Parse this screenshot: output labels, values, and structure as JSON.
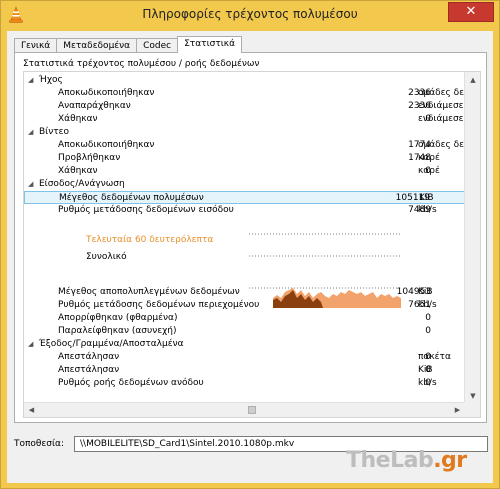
{
  "window": {
    "title": "Πληροφορίες τρέχοντος πολυμέσου",
    "close_glyph": "✕",
    "accent": "#f2c94c"
  },
  "tabs": [
    {
      "label": "Γενικά"
    },
    {
      "label": "Μεταδεδομένα"
    },
    {
      "label": "Codec"
    },
    {
      "label": "Στατιστικά",
      "active": true
    }
  ],
  "panel": {
    "caption": "Στατιστικά τρέχοντος πολυμέσου / ροής δεδομένων"
  },
  "tree": {
    "audio": {
      "label": "Ήχος",
      "rows": [
        {
          "label": "Αποκωδικοποιήθηκαν",
          "value": "2336",
          "unit": "ομάδες δεδομένων"
        },
        {
          "label": "Αναπαράχθηκαν",
          "value": "2336",
          "unit": "ενδιάμεσες μνήμης"
        },
        {
          "label": "Χάθηκαν",
          "value": "0",
          "unit": "ενδιάμεσες μνήμης"
        }
      ]
    },
    "video": {
      "label": "Βίντεο",
      "rows": [
        {
          "label": "Αποκωδικοποιήθηκαν",
          "value": "1774",
          "unit": "ομάδες δεδομένων"
        },
        {
          "label": "Προβλήθηκαν",
          "value": "1748",
          "unit": "καρέ"
        },
        {
          "label": "Χάθηκαν",
          "value": "0",
          "unit": "καρέ"
        }
      ]
    },
    "input": {
      "label": "Είσοδος/Ανάγνωση",
      "rows": [
        {
          "label": "Μέγεθος δεδομένων πολυμέσων",
          "value": "105119",
          "unit": "KiB"
        },
        {
          "label": "Ρυθμός μετάδοσης δεδομένων εισόδου",
          "value": "7489",
          "unit": "kb/s"
        }
      ],
      "graph": {
        "legend_last60": "Τελευταία 60 δευτερόλεπτα",
        "legend_total": "Συνολικό"
      },
      "rows2": [
        {
          "label": "Μέγεθος αποπολυπλεγμένων δεδομένων",
          "value": "104953",
          "unit": "KiB"
        },
        {
          "label": "Ρυθμός μετάδοσης δεδομένων περιεχομένου",
          "value": "7651",
          "unit": "kb/s"
        },
        {
          "label": "Απορρίφθηκαν (φθαρμένα)",
          "value": "0",
          "unit": ""
        },
        {
          "label": "Παραλείφθηκαν (ασυνεχή)",
          "value": "0",
          "unit": ""
        }
      ]
    },
    "output": {
      "label": "Έξοδος/Γραμμένα/Αποσταλμένα",
      "rows": [
        {
          "label": "Απεστάλησαν",
          "value": "0",
          "unit": "πακέτα"
        },
        {
          "label": "Απεστάλησαν",
          "value": "0",
          "unit": "KiB"
        },
        {
          "label": "Ρυθμός ροής δεδομένων ανόδου",
          "value": "0",
          "unit": "kb/s"
        }
      ]
    }
  },
  "location": {
    "label": "Τοποθεσία:",
    "value": "\\\\MOBILELITE\\SD_Card1\\Sintel.2010.1080p.mkv"
  },
  "watermark": {
    "text_a": "TheLab",
    "text_b": ".gr"
  },
  "icons": {
    "expand": "expand-arrow-icon",
    "app": "vlc-cone-icon"
  }
}
